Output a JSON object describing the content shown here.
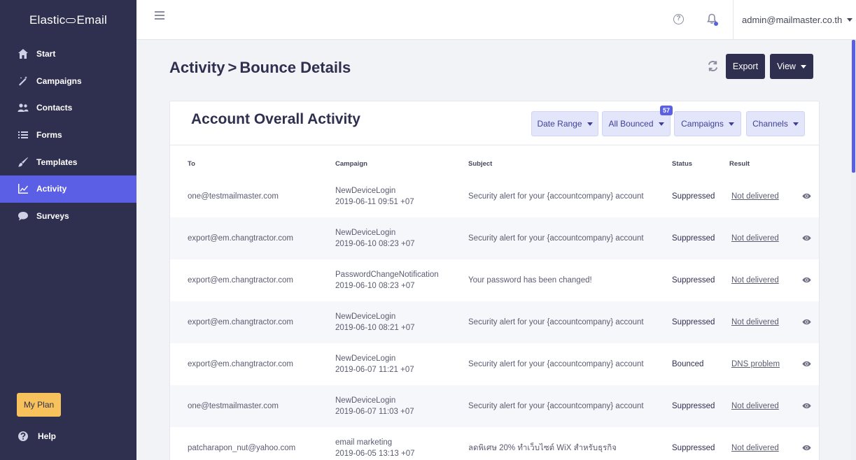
{
  "brand": {
    "left": "Elastic",
    "right": "Email"
  },
  "sidebar": {
    "items": [
      {
        "label": "Start",
        "icon": "home-icon"
      },
      {
        "label": "Campaigns",
        "icon": "magic-wand-icon"
      },
      {
        "label": "Contacts",
        "icon": "users-icon"
      },
      {
        "label": "Forms",
        "icon": "list-icon"
      },
      {
        "label": "Templates",
        "icon": "brush-icon"
      },
      {
        "label": "Activity",
        "icon": "chart-line-icon",
        "active": true
      },
      {
        "label": "Surveys",
        "icon": "chat-bubble-icon"
      }
    ],
    "my_plan": "My Plan",
    "help": "Help"
  },
  "topbar": {
    "help_symbol": "?",
    "user": "admin@mailmaster.co.th"
  },
  "page": {
    "breadcrumb_parent": "Activity",
    "breadcrumb_sep": ">",
    "breadcrumb_current": "Bounce Details",
    "export_label": "Export",
    "view_label": "View"
  },
  "card": {
    "title": "Account Overall Activity",
    "filters": {
      "date_range": "Date Range",
      "all_bounced": "All Bounced",
      "all_bounced_count": "57",
      "campaigns": "Campaigns",
      "channels": "Channels"
    },
    "columns": {
      "to": "To",
      "campaign": "Campaign",
      "subject": "Subject",
      "status": "Status",
      "result": "Result"
    },
    "rows": [
      {
        "to": "one@testmailmaster.com",
        "campaign": "NewDeviceLogin",
        "date": "2019-06-11 09:51 +07",
        "subject": "Security alert for your {accountcompany} account",
        "status": "Suppressed",
        "result": "Not delivered"
      },
      {
        "to": "export@em.changtractor.com",
        "campaign": "NewDeviceLogin",
        "date": "2019-06-10 08:23 +07",
        "subject": "Security alert for your {accountcompany} account",
        "status": "Suppressed",
        "result": "Not delivered"
      },
      {
        "to": "export@em.changtractor.com",
        "campaign": "PasswordChangeNotification",
        "date": "2019-06-10 08:23 +07",
        "subject": "Your password has been changed!",
        "status": "Suppressed",
        "result": "Not delivered"
      },
      {
        "to": "export@em.changtractor.com",
        "campaign": "NewDeviceLogin",
        "date": "2019-06-10 08:21 +07",
        "subject": "Security alert for your {accountcompany} account",
        "status": "Suppressed",
        "result": "Not delivered"
      },
      {
        "to": "export@em.changtractor.com",
        "campaign": "NewDeviceLogin",
        "date": "2019-06-07 11:21 +07",
        "subject": "Security alert for your {accountcompany} account",
        "status": "Bounced",
        "result": "DNS problem"
      },
      {
        "to": "one@testmailmaster.com",
        "campaign": "NewDeviceLogin",
        "date": "2019-06-07 11:03 +07",
        "subject": "Security alert for your {accountcompany} account",
        "status": "Suppressed",
        "result": "Not delivered"
      },
      {
        "to": "patcharapon_nut@yahoo.com",
        "campaign": "email marketing",
        "date": "2019-06-05 13:13 +07",
        "subject": "ลดพิเศษ 20% ทำเว็บไซต์ WiX สำหรับธุรกิจ",
        "status": "Suppressed",
        "result": "Not delivered"
      }
    ]
  },
  "colors": {
    "sidebar_bg": "#2f2f4f",
    "accent": "#5a5fe6",
    "plan_button": "#f7c25c",
    "filter_bg": "#e3e6fb"
  }
}
